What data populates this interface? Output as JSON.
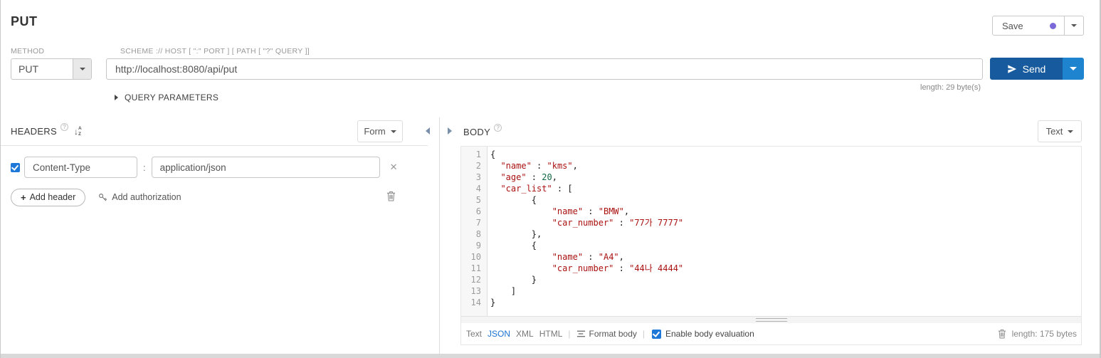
{
  "header": {
    "title": "PUT",
    "save_label": "Save"
  },
  "request": {
    "method_label": "METHOD",
    "scheme_label": "SCHEME :// HOST [ \":\" PORT ] [ PATH [ \"?\" QUERY ]]",
    "method_value": "PUT",
    "url_value": "http://localhost:8080/api/put",
    "send_label": "Send",
    "url_length": "length: 29 byte(s)",
    "query_parameters_label": "QUERY PARAMETERS"
  },
  "headers_panel": {
    "title": "HEADERS",
    "help_icon": "?",
    "view_mode": "Form",
    "row": {
      "enabled": true,
      "name": "Content-Type",
      "value": "application/json",
      "separator": ":",
      "remove": "✕"
    },
    "add_header_label": "Add header",
    "add_authorization_label": "Add authorization"
  },
  "body_panel": {
    "title": "BODY",
    "help_icon": "?",
    "view_mode": "Text",
    "editor_lines": [
      [
        {
          "t": "{",
          "c": "p"
        }
      ],
      [
        {
          "t": "  ",
          "c": "p"
        },
        {
          "t": "\"name\"",
          "c": "s"
        },
        {
          "t": " : ",
          "c": "p"
        },
        {
          "t": "\"kms\"",
          "c": "s"
        },
        {
          "t": ",",
          "c": "p"
        }
      ],
      [
        {
          "t": "  ",
          "c": "p"
        },
        {
          "t": "\"age\"",
          "c": "s"
        },
        {
          "t": " : ",
          "c": "p"
        },
        {
          "t": "20",
          "c": "n"
        },
        {
          "t": ",",
          "c": "p"
        }
      ],
      [
        {
          "t": "  ",
          "c": "p"
        },
        {
          "t": "\"car_list\"",
          "c": "s"
        },
        {
          "t": " : [",
          "c": "p"
        }
      ],
      [
        {
          "t": "        {",
          "c": "p"
        }
      ],
      [
        {
          "t": "            ",
          "c": "p"
        },
        {
          "t": "\"name\"",
          "c": "s"
        },
        {
          "t": " : ",
          "c": "p"
        },
        {
          "t": "\"BMW\"",
          "c": "s"
        },
        {
          "t": ",",
          "c": "p"
        }
      ],
      [
        {
          "t": "            ",
          "c": "p"
        },
        {
          "t": "\"car_number\"",
          "c": "s"
        },
        {
          "t": " : ",
          "c": "p"
        },
        {
          "t": "\"77가 7777\"",
          "c": "s"
        }
      ],
      [
        {
          "t": "        },",
          "c": "p"
        }
      ],
      [
        {
          "t": "        {",
          "c": "p"
        }
      ],
      [
        {
          "t": "            ",
          "c": "p"
        },
        {
          "t": "\"name\"",
          "c": "s"
        },
        {
          "t": " : ",
          "c": "p"
        },
        {
          "t": "\"A4\"",
          "c": "s"
        },
        {
          "t": ",",
          "c": "p"
        }
      ],
      [
        {
          "t": "            ",
          "c": "p"
        },
        {
          "t": "\"car_number\"",
          "c": "s"
        },
        {
          "t": " : ",
          "c": "p"
        },
        {
          "t": "\"44나 4444\"",
          "c": "s"
        }
      ],
      [
        {
          "t": "        }",
          "c": "p"
        }
      ],
      [
        {
          "t": "    ]",
          "c": "p"
        }
      ],
      [
        {
          "t": "}",
          "c": "p"
        }
      ]
    ],
    "toolbar": {
      "modes": [
        "Text",
        "JSON",
        "XML",
        "HTML"
      ],
      "active_mode": "JSON",
      "format_label": "Format body",
      "evaluation_label": "Enable body evaluation",
      "evaluation_checked": true,
      "length_label": "length: 175 bytes"
    }
  },
  "colors": {
    "send_button": "#175a9d",
    "send_caret": "#1e84cf",
    "save_dot": "#7b68d9",
    "checkbox_blue": "#1e78d7",
    "active_mode_link": "#1a73d1",
    "string_token": "#aa1111",
    "number_token": "#116644"
  }
}
